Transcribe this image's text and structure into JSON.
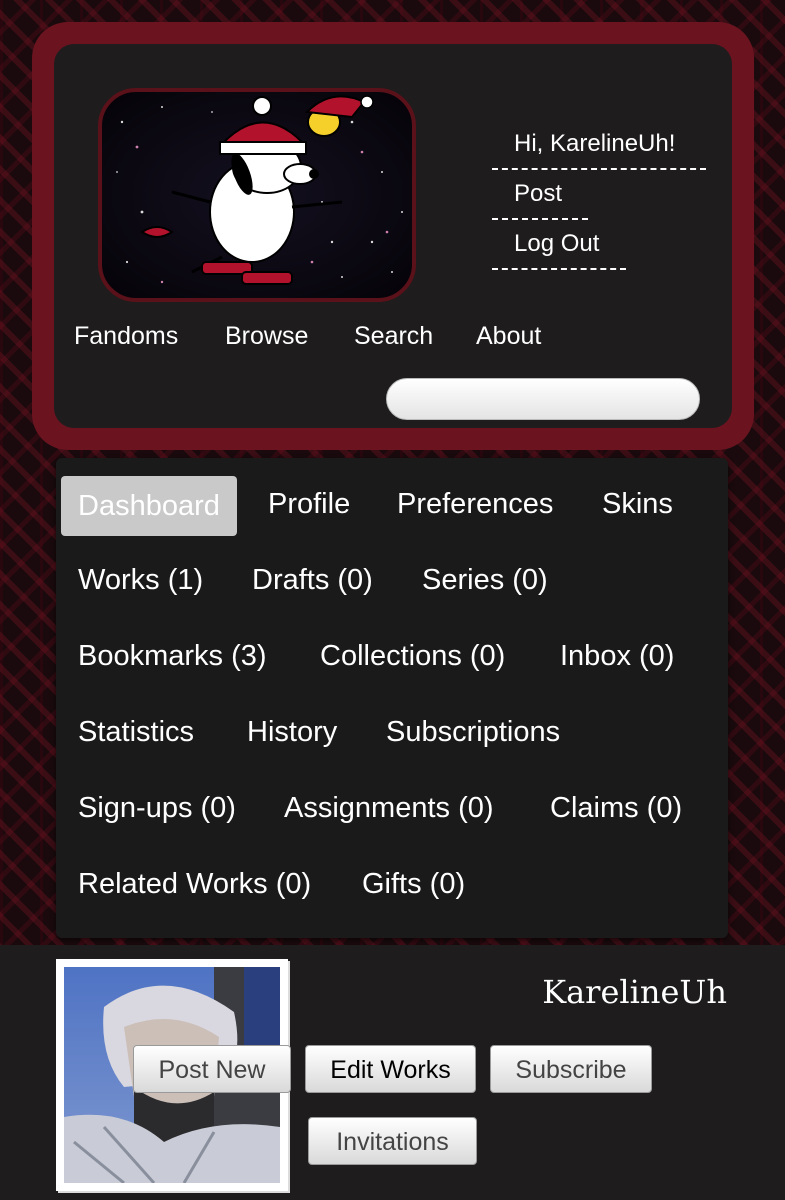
{
  "header": {
    "user_menu": {
      "greeting": "Hi, KarelineUh!",
      "post": "Post",
      "logout": "Log Out"
    },
    "nav": [
      "Fandoms",
      "Browse",
      "Search",
      "About"
    ]
  },
  "dashboard_nav": {
    "items": [
      {
        "label": "Dashboard",
        "active": true
      },
      {
        "label": "Profile"
      },
      {
        "label": "Preferences"
      },
      {
        "label": "Skins"
      },
      {
        "label": "Works (1)"
      },
      {
        "label": "Drafts (0)"
      },
      {
        "label": "Series (0)"
      },
      {
        "label": "Bookmarks (3)"
      },
      {
        "label": "Collections (0)"
      },
      {
        "label": "Inbox (0)"
      },
      {
        "label": "Statistics"
      },
      {
        "label": "History"
      },
      {
        "label": "Subscriptions"
      },
      {
        "label": "Sign-ups (0)"
      },
      {
        "label": "Assignments (0)"
      },
      {
        "label": "Claims (0)"
      },
      {
        "label": "Related Works (0)"
      },
      {
        "label": "Gifts (0)"
      }
    ]
  },
  "profile": {
    "username": "KarelineUh",
    "buttons": {
      "post_new": "Post New",
      "edit_works": "Edit Works",
      "subscribe": "Subscribe",
      "invitations": "Invitations"
    }
  },
  "colors": {
    "frame": "#6b1420",
    "panel": "#1e1c1d",
    "active_tab": "#c9c9c9",
    "text": "#ffffff"
  }
}
